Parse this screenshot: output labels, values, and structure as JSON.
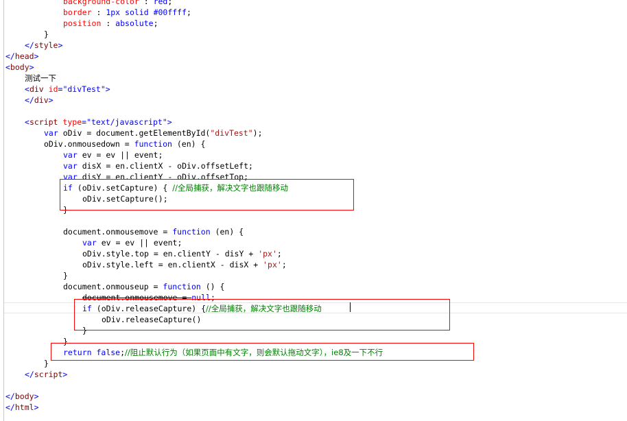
{
  "lines": [
    [
      {
        "c": "attr",
        "t": "background-color"
      },
      {
        "c": "plain",
        "t": " : "
      },
      {
        "c": "str",
        "t": "red"
      },
      {
        "c": "plain",
        "t": ";"
      }
    ],
    [
      {
        "c": "attr",
        "t": "border"
      },
      {
        "c": "plain",
        "t": " : "
      },
      {
        "c": "str",
        "t": "1px solid #00ffff"
      },
      {
        "c": "plain",
        "t": ";"
      }
    ],
    [
      {
        "c": "attr",
        "t": "position"
      },
      {
        "c": "plain",
        "t": " : "
      },
      {
        "c": "str",
        "t": "absolute"
      },
      {
        "c": "plain",
        "t": ";"
      }
    ],
    [
      {
        "c": "plain",
        "t": "}"
      }
    ],
    [
      {
        "c": "kw",
        "t": "</"
      },
      {
        "c": "tag",
        "t": "style"
      },
      {
        "c": "kw",
        "t": ">"
      }
    ],
    [
      {
        "c": "kw",
        "t": "</"
      },
      {
        "c": "tag",
        "t": "head"
      },
      {
        "c": "kw",
        "t": ">"
      }
    ],
    [
      {
        "c": "kw",
        "t": "<"
      },
      {
        "c": "tag",
        "t": "body"
      },
      {
        "c": "kw",
        "t": ">"
      }
    ],
    [
      {
        "c": "plain",
        "t": "测试一下"
      }
    ],
    [
      {
        "c": "kw",
        "t": "<"
      },
      {
        "c": "tag",
        "t": "div"
      },
      {
        "c": "plain",
        "t": " "
      },
      {
        "c": "attr",
        "t": "id"
      },
      {
        "c": "kw",
        "t": "="
      },
      {
        "c": "str",
        "t": "\"divTest\""
      },
      {
        "c": "kw",
        "t": ">"
      }
    ],
    [
      {
        "c": "kw",
        "t": "</"
      },
      {
        "c": "tag",
        "t": "div"
      },
      {
        "c": "kw",
        "t": ">"
      }
    ],
    [],
    [
      {
        "c": "kw",
        "t": "<"
      },
      {
        "c": "tag",
        "t": "script"
      },
      {
        "c": "plain",
        "t": " "
      },
      {
        "c": "attr",
        "t": "type"
      },
      {
        "c": "kw",
        "t": "="
      },
      {
        "c": "str",
        "t": "\"text/javascript\""
      },
      {
        "c": "kw",
        "t": ">"
      }
    ],
    [
      {
        "c": "kw",
        "t": "var"
      },
      {
        "c": "plain",
        "t": " oDiv = document.getElementById("
      },
      {
        "c": "jsstr",
        "t": "\"divTest\""
      },
      {
        "c": "plain",
        "t": ");"
      }
    ],
    [
      {
        "c": "plain",
        "t": "oDiv.onmousedown = "
      },
      {
        "c": "kw",
        "t": "function"
      },
      {
        "c": "plain",
        "t": " (en) {"
      }
    ],
    [
      {
        "c": "kw",
        "t": "var"
      },
      {
        "c": "plain",
        "t": " ev = ev || event;"
      }
    ],
    [
      {
        "c": "kw",
        "t": "var"
      },
      {
        "c": "plain",
        "t": " disX = en.clientX - oDiv.offsetLeft;"
      }
    ],
    [
      {
        "c": "kw",
        "t": "var"
      },
      {
        "c": "plain",
        "t": " disY = en.clientY - oDiv.offsetTop;"
      }
    ],
    [
      {
        "c": "kw",
        "t": "if"
      },
      {
        "c": "plain",
        "t": " (oDiv.setCapture) { "
      },
      {
        "c": "comment",
        "t": "//全局捕获，解决文字也跟随移动"
      }
    ],
    [
      {
        "c": "plain",
        "t": "oDiv.setCapture();"
      }
    ],
    [
      {
        "c": "plain",
        "t": "}"
      }
    ],
    [],
    [
      {
        "c": "plain",
        "t": "document.onmousemove = "
      },
      {
        "c": "kw",
        "t": "function"
      },
      {
        "c": "plain",
        "t": " (en) {"
      }
    ],
    [
      {
        "c": "kw",
        "t": "var"
      },
      {
        "c": "plain",
        "t": " ev = ev || event;"
      }
    ],
    [
      {
        "c": "plain",
        "t": "oDiv.style.top = en.clientY - disY + "
      },
      {
        "c": "jsstr",
        "t": "'px'"
      },
      {
        "c": "plain",
        "t": ";"
      }
    ],
    [
      {
        "c": "plain",
        "t": "oDiv.style.left = en.clientX - disX + "
      },
      {
        "c": "jsstr",
        "t": "'px'"
      },
      {
        "c": "plain",
        "t": ";"
      }
    ],
    [
      {
        "c": "plain",
        "t": "}"
      }
    ],
    [
      {
        "c": "plain",
        "t": "document.onmouseup = "
      },
      {
        "c": "kw",
        "t": "function"
      },
      {
        "c": "plain",
        "t": " () {"
      }
    ],
    [
      {
        "c": "plain",
        "t": "document.onmousemove = "
      },
      {
        "c": "kw",
        "t": "null"
      },
      {
        "c": "plain",
        "t": ";"
      }
    ],
    [
      {
        "c": "kw",
        "t": "if"
      },
      {
        "c": "plain",
        "t": " (oDiv.releaseCapture) {"
      },
      {
        "c": "comment",
        "t": "//全局捕获，解决文字也跟随移动"
      }
    ],
    [
      {
        "c": "plain",
        "t": "oDiv.releaseCapture()"
      }
    ],
    [
      {
        "c": "plain",
        "t": "}"
      }
    ],
    [
      {
        "c": "plain",
        "t": "}"
      }
    ],
    [
      {
        "c": "kw",
        "t": "return"
      },
      {
        "c": "plain",
        "t": " "
      },
      {
        "c": "kw",
        "t": "false"
      },
      {
        "c": "plain",
        "t": ";"
      },
      {
        "c": "comment",
        "t": "//阻止默认行为（如果页面中有文字，则会默认拖动文字），ie8及一下不行"
      }
    ],
    [
      {
        "c": "plain",
        "t": "}"
      }
    ],
    [
      {
        "c": "kw",
        "t": "</"
      },
      {
        "c": "tag",
        "t": "script"
      },
      {
        "c": "kw",
        "t": ">"
      }
    ],
    [],
    [
      {
        "c": "kw",
        "t": "</"
      },
      {
        "c": "tag",
        "t": "body"
      },
      {
        "c": "kw",
        "t": ">"
      }
    ],
    [
      {
        "c": "kw",
        "t": "</"
      },
      {
        "c": "tag",
        "t": "html"
      },
      {
        "c": "kw",
        "t": ">"
      }
    ]
  ]
}
